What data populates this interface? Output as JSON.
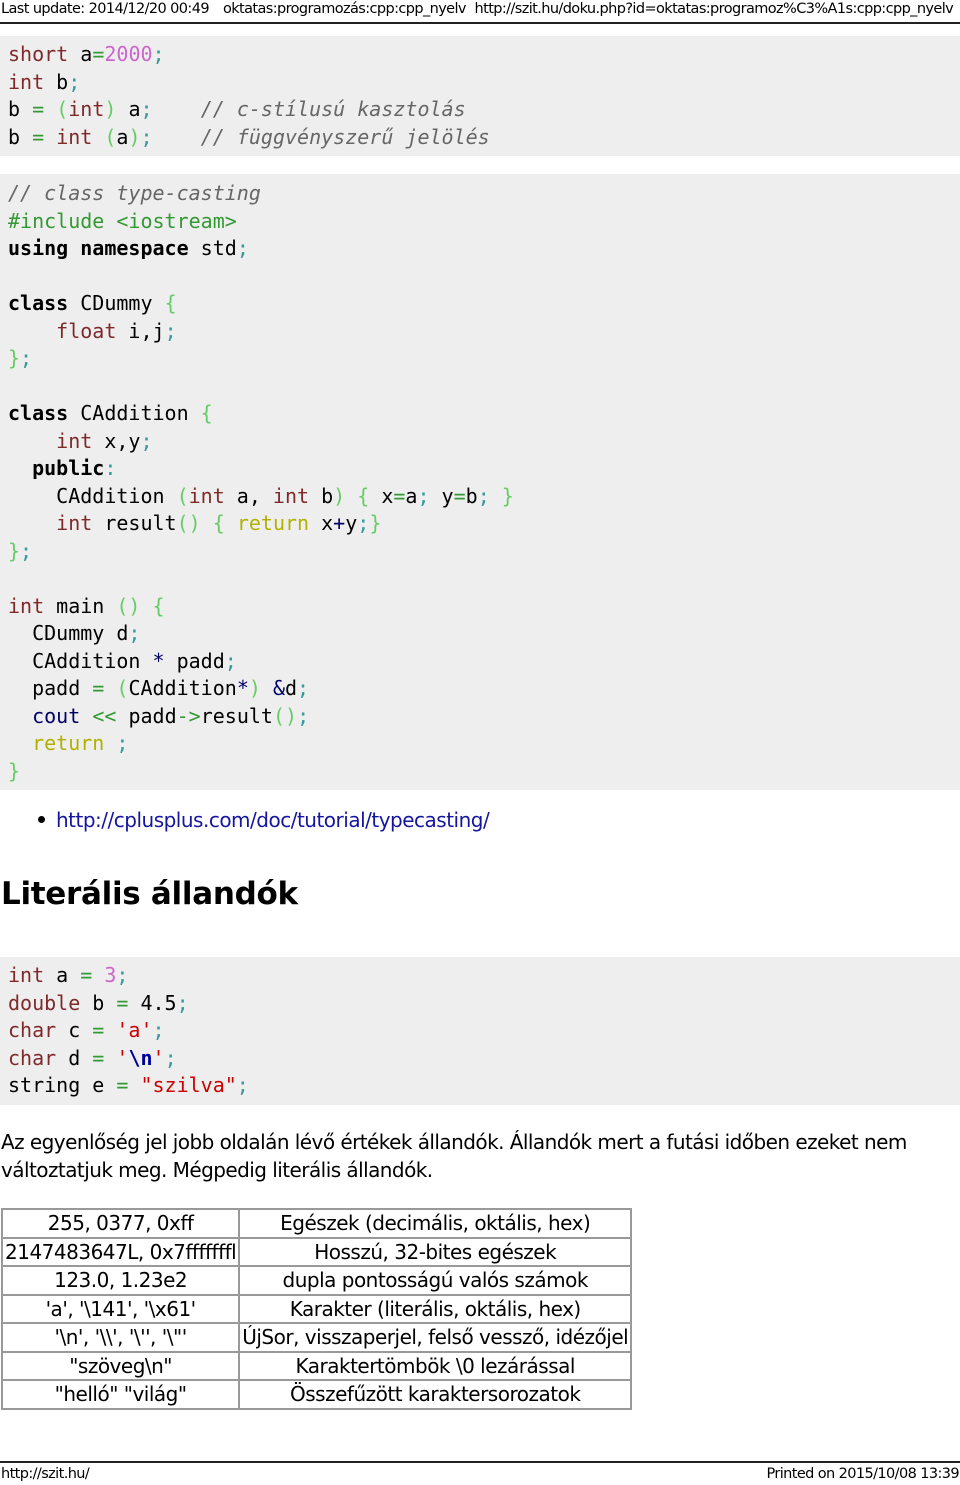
{
  "header": {
    "last_update": "Last update: 2014/12/20 00:49",
    "page_id": "oktatas:programozás:cpp:cpp_nyelv",
    "url": "http://szit.hu/doku.php?id=oktatas:programoz%C3%A1s:cpp:cpp_nyelv"
  },
  "code_block_1": {
    "lines": [
      [
        {
          "t": "short",
          "c": "kw"
        },
        {
          "t": " a",
          "c": ""
        },
        {
          "t": "=",
          "c": "op"
        },
        {
          "t": "2000",
          "c": "num"
        },
        {
          "t": ";",
          "c": "sc"
        }
      ],
      [
        {
          "t": "int",
          "c": "kw"
        },
        {
          "t": " b",
          "c": ""
        },
        {
          "t": ";",
          "c": "sc"
        }
      ],
      [
        {
          "t": "b ",
          "c": ""
        },
        {
          "t": "=",
          "c": "op"
        },
        {
          "t": " ",
          "c": ""
        },
        {
          "t": "(",
          "c": "br"
        },
        {
          "t": "int",
          "c": "kw"
        },
        {
          "t": ")",
          "c": "br"
        },
        {
          "t": " a",
          "c": ""
        },
        {
          "t": ";",
          "c": "sc"
        },
        {
          "t": "    ",
          "c": ""
        },
        {
          "t": "// c-stílusú kasztolás",
          "c": "cm"
        }
      ],
      [
        {
          "t": "b ",
          "c": ""
        },
        {
          "t": "=",
          "c": "op"
        },
        {
          "t": " ",
          "c": ""
        },
        {
          "t": "int",
          "c": "kw"
        },
        {
          "t": " ",
          "c": ""
        },
        {
          "t": "(",
          "c": "br"
        },
        {
          "t": "a",
          "c": ""
        },
        {
          "t": ")",
          "c": "br"
        },
        {
          "t": ";",
          "c": "sc"
        },
        {
          "t": "    ",
          "c": ""
        },
        {
          "t": "// függvényszerű jelölés",
          "c": "cm"
        }
      ]
    ]
  },
  "code_block_2": {
    "lines": [
      [
        {
          "t": "// class type-casting",
          "c": "cm"
        }
      ],
      [
        {
          "t": "#include <iostream>",
          "c": "pp"
        }
      ],
      [
        {
          "t": "using",
          "c": "kwb"
        },
        {
          "t": " ",
          "c": ""
        },
        {
          "t": "namespace",
          "c": "kwb"
        },
        {
          "t": " std",
          "c": ""
        },
        {
          "t": ";",
          "c": "sc"
        }
      ],
      [],
      [
        {
          "t": "class",
          "c": "kwb"
        },
        {
          "t": " CDummy ",
          "c": ""
        },
        {
          "t": "{",
          "c": "br"
        }
      ],
      [
        {
          "t": "    ",
          "c": ""
        },
        {
          "t": "float",
          "c": "kw"
        },
        {
          "t": " i,j",
          "c": ""
        },
        {
          "t": ";",
          "c": "sc"
        }
      ],
      [
        {
          "t": "}",
          "c": "br"
        },
        {
          "t": ";",
          "c": "sc"
        }
      ],
      [],
      [
        {
          "t": "class",
          "c": "kwb"
        },
        {
          "t": " CAddition ",
          "c": ""
        },
        {
          "t": "{",
          "c": "br"
        }
      ],
      [
        {
          "t": "    ",
          "c": ""
        },
        {
          "t": "int",
          "c": "kw"
        },
        {
          "t": " x,y",
          "c": ""
        },
        {
          "t": ";",
          "c": "sc"
        }
      ],
      [
        {
          "t": "  ",
          "c": ""
        },
        {
          "t": "public",
          "c": "kwb"
        },
        {
          "t": ":",
          "c": "sc"
        }
      ],
      [
        {
          "t": "    CAddition ",
          "c": ""
        },
        {
          "t": "(",
          "c": "br"
        },
        {
          "t": "int",
          "c": "kw"
        },
        {
          "t": " a, ",
          "c": ""
        },
        {
          "t": "int",
          "c": "kw"
        },
        {
          "t": " b",
          "c": ""
        },
        {
          "t": ")",
          "c": "br"
        },
        {
          "t": " ",
          "c": ""
        },
        {
          "t": "{",
          "c": "br"
        },
        {
          "t": " x",
          "c": ""
        },
        {
          "t": "=",
          "c": "op"
        },
        {
          "t": "a",
          "c": ""
        },
        {
          "t": ";",
          "c": "sc"
        },
        {
          "t": " y",
          "c": ""
        },
        {
          "t": "=",
          "c": "op"
        },
        {
          "t": "b",
          "c": ""
        },
        {
          "t": ";",
          "c": "sc"
        },
        {
          "t": " ",
          "c": ""
        },
        {
          "t": "}",
          "c": "br"
        }
      ],
      [
        {
          "t": "    ",
          "c": ""
        },
        {
          "t": "int",
          "c": "kw"
        },
        {
          "t": " result",
          "c": ""
        },
        {
          "t": "()",
          "c": "br"
        },
        {
          "t": " ",
          "c": ""
        },
        {
          "t": "{",
          "c": "br"
        },
        {
          "t": " ",
          "c": ""
        },
        {
          "t": "return",
          "c": "rt"
        },
        {
          "t": " x",
          "c": ""
        },
        {
          "t": "+",
          "c": "io"
        },
        {
          "t": "y",
          "c": ""
        },
        {
          "t": ";",
          "c": "sc"
        },
        {
          "t": "}",
          "c": "br"
        }
      ],
      [
        {
          "t": "}",
          "c": "br"
        },
        {
          "t": ";",
          "c": "sc"
        }
      ],
      [],
      [
        {
          "t": "int",
          "c": "kw"
        },
        {
          "t": " main ",
          "c": ""
        },
        {
          "t": "()",
          "c": "br"
        },
        {
          "t": " ",
          "c": ""
        },
        {
          "t": "{",
          "c": "br"
        }
      ],
      [
        {
          "t": "  CDummy d",
          "c": ""
        },
        {
          "t": ";",
          "c": "sc"
        }
      ],
      [
        {
          "t": "  CAddition ",
          "c": ""
        },
        {
          "t": "*",
          "c": "io"
        },
        {
          "t": " padd",
          "c": ""
        },
        {
          "t": ";",
          "c": "sc"
        }
      ],
      [
        {
          "t": "  padd ",
          "c": ""
        },
        {
          "t": "=",
          "c": "op"
        },
        {
          "t": " ",
          "c": ""
        },
        {
          "t": "(",
          "c": "br"
        },
        {
          "t": "CAddition",
          "c": ""
        },
        {
          "t": "*",
          "c": "io"
        },
        {
          "t": ")",
          "c": "br"
        },
        {
          "t": " ",
          "c": ""
        },
        {
          "t": "&",
          "c": "io"
        },
        {
          "t": "d",
          "c": ""
        },
        {
          "t": ";",
          "c": "sc"
        }
      ],
      [
        {
          "t": "  ",
          "c": ""
        },
        {
          "t": "cout",
          "c": "io"
        },
        {
          "t": " ",
          "c": ""
        },
        {
          "t": "<<",
          "c": "op"
        },
        {
          "t": " padd",
          "c": ""
        },
        {
          "t": "->",
          "c": "op"
        },
        {
          "t": "result",
          "c": ""
        },
        {
          "t": "()",
          "c": "br"
        },
        {
          "t": ";",
          "c": "sc"
        }
      ],
      [
        {
          "t": "  ",
          "c": ""
        },
        {
          "t": "return",
          "c": "rt"
        },
        {
          "t": " ",
          "c": ""
        },
        {
          "t": ";",
          "c": "sc"
        }
      ],
      [
        {
          "t": "}",
          "c": "br"
        }
      ]
    ]
  },
  "links": [
    {
      "label": "http://cplusplus.com/doc/tutorial/typecasting/"
    }
  ],
  "section": {
    "title": "Literális állandók"
  },
  "code_block_3": {
    "lines": [
      [
        {
          "t": "int",
          "c": "kw"
        },
        {
          "t": " a ",
          "c": ""
        },
        {
          "t": "=",
          "c": "op"
        },
        {
          "t": " ",
          "c": ""
        },
        {
          "t": "3",
          "c": "num"
        },
        {
          "t": ";",
          "c": "sc"
        }
      ],
      [
        {
          "t": "double",
          "c": "kw"
        },
        {
          "t": " b ",
          "c": ""
        },
        {
          "t": "=",
          "c": "op"
        },
        {
          "t": " 4.5",
          "c": ""
        },
        {
          "t": ";",
          "c": "sc"
        }
      ],
      [
        {
          "t": "char",
          "c": "kw"
        },
        {
          "t": " c ",
          "c": ""
        },
        {
          "t": "=",
          "c": "op"
        },
        {
          "t": " ",
          "c": ""
        },
        {
          "t": "'a'",
          "c": "str"
        },
        {
          "t": ";",
          "c": "sc"
        }
      ],
      [
        {
          "t": "char",
          "c": "kw"
        },
        {
          "t": " d ",
          "c": ""
        },
        {
          "t": "=",
          "c": "op"
        },
        {
          "t": " ",
          "c": ""
        },
        {
          "t": "'",
          "c": "str"
        },
        {
          "t": "\\n",
          "c": "esc"
        },
        {
          "t": "'",
          "c": "str"
        },
        {
          "t": ";",
          "c": "sc"
        }
      ],
      [
        {
          "t": "string e ",
          "c": ""
        },
        {
          "t": "=",
          "c": "op"
        },
        {
          "t": " ",
          "c": ""
        },
        {
          "t": "\"szilva\"",
          "c": "str"
        },
        {
          "t": ";",
          "c": "sc"
        }
      ]
    ]
  },
  "paragraph": "Az egyenlőség jel jobb oldalán lévő értékek állandók. Állandók mert a futási időben ezeket nem változtatjuk meg. Mégpedig literális állandók.",
  "literal_table": {
    "rows": [
      {
        "literal": "255, 0377, 0xff",
        "description": "Egészek (decimális, oktális, hex)"
      },
      {
        "literal": "2147483647L, 0x7fffffffl",
        "description": "Hosszú, 32-bites egészek"
      },
      {
        "literal": "123.0, 1.23e2",
        "description": "dupla pontosságú valós számok"
      },
      {
        "literal": "'a', '\\141', '\\x61'",
        "description": "Karakter (literális, oktális, hex)"
      },
      {
        "literal": "'\\n', '\\\\', '\\'', '\\\"'",
        "description": "ÚjSor, visszaperjel, felső vessző, idézőjel"
      },
      {
        "literal": "\"szöveg\\n\"",
        "description": "Karaktertömbök \\0 lezárással"
      },
      {
        "literal": "\"helló\" \"világ\"",
        "description": "Összefűzött karaktersorozatok"
      }
    ]
  },
  "footer": {
    "site": "http://szit.hu/",
    "printed": "Printed on 2015/10/08 13:39"
  }
}
